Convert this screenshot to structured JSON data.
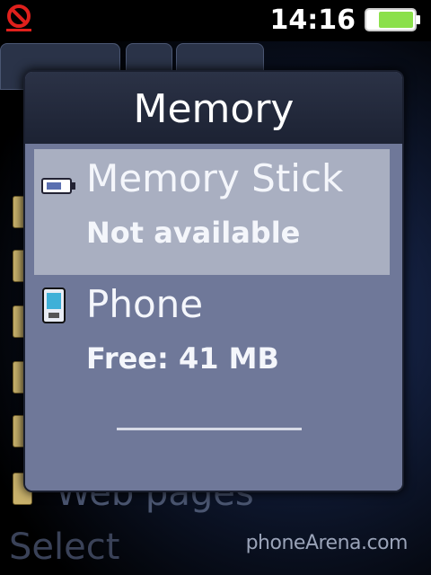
{
  "status_bar": {
    "time": "14:16",
    "silent_icon": "silent-mode-icon",
    "battery_icon": "battery-full-icon",
    "battery_color": "#8be04a"
  },
  "background": {
    "webpages_label": "Web pages",
    "softkey_left": "Select",
    "watermark": "phoneArena.com"
  },
  "dialog": {
    "title": "Memory",
    "items": [
      {
        "name": "Memory Stick",
        "status": "Not available",
        "icon": "memory-stick-icon",
        "selected": true
      },
      {
        "name": "Phone",
        "status": "Free: 41 MB",
        "icon": "phone-memory-icon",
        "selected": false
      }
    ]
  },
  "colors": {
    "dialog_body": "#6f7899",
    "selected_item": "#a9afc1",
    "header": "#1c2233"
  }
}
